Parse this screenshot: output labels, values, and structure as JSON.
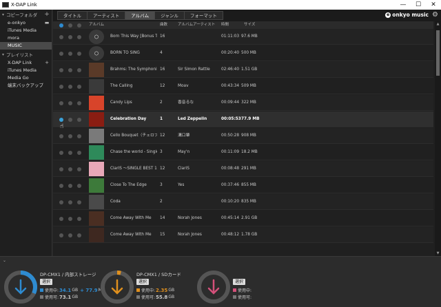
{
  "window": {
    "title": "X-DAP Link",
    "minimize": "—",
    "maximize": "☐",
    "close": "✕"
  },
  "sidebar": {
    "folders_header": "コピーフォルダ",
    "folders": [
      {
        "label": "e-onkyo",
        "folder_icon": true
      },
      {
        "label": "iTunes Media"
      },
      {
        "label": "mora"
      },
      {
        "label": "MUSIC",
        "active": true
      }
    ],
    "playlists_header": "プレイリスト",
    "playlists": [
      {
        "label": "X-DAP Link",
        "plus": true
      },
      {
        "label": "iTunes Media"
      },
      {
        "label": "Media Go"
      },
      {
        "label": "端末バックアップ"
      }
    ]
  },
  "tabs": [
    {
      "label": "タイトル"
    },
    {
      "label": "アーティスト"
    },
    {
      "label": "アルバム",
      "active": true
    },
    {
      "label": "ジャンル"
    },
    {
      "label": "フォーマット"
    }
  ],
  "brand": {
    "logo": "e",
    "label": "onkyo music"
  },
  "table": {
    "headers": {
      "album": "アルバム",
      "tracks": "曲数",
      "album_artist": "アルバムアーティスト",
      "time": "時間",
      "size": "サイズ"
    },
    "rows": [
      {
        "album": "Born This Way [Bonus Tr",
        "tracks": "16",
        "artist": "",
        "time": "01:11:03",
        "size": "97.6 MB",
        "art": "disc"
      },
      {
        "album": "BORN TO SING",
        "tracks": "4",
        "artist": "",
        "time": "00:20:40",
        "size": "500 MB",
        "art": "disc"
      },
      {
        "album": "Brahms: The Symphonie",
        "tracks": "16",
        "artist": "Sir Simon Rattle",
        "time": "02:46:40",
        "size": "1.51 GB",
        "art": "#5a3a28"
      },
      {
        "album": "The Calling",
        "tracks": "12",
        "artist": "Moav",
        "time": "00:43:34",
        "size": "509 MB",
        "art": "#3a3a3a"
      },
      {
        "album": "Candy Lips",
        "tracks": "2",
        "artist": "香音るな",
        "time": "00:09:44",
        "size": "322 MB",
        "art": "#d8442a"
      },
      {
        "album": "Celebration Day",
        "tracks": "1",
        "artist": "Led Zeppelin",
        "time": "00:05:53",
        "size": "77.9 MB",
        "art": "#8a1d12",
        "highlight": true
      },
      {
        "album": "Cello Bouquet（チェロブーケ",
        "tracks": "12",
        "artist": "溝口肇",
        "time": "00:50:28",
        "size": "908 MB",
        "art": "#7a7a7a"
      },
      {
        "album": "Chase the world - Single",
        "tracks": "3",
        "artist": "May'n",
        "time": "00:11:09",
        "size": "18.2 MB",
        "art": "#2e8a5a"
      },
      {
        "album": "ClariS ～SINGLE BEST 1s",
        "tracks": "12",
        "artist": "ClariS",
        "time": "00:08:48",
        "size": "291 MB",
        "art": "#e8a8b8"
      },
      {
        "album": "Close To The Edge",
        "tracks": "3",
        "artist": "Yes",
        "time": "00:37:46",
        "size": "855 MB",
        "art": "#3d7a3a"
      },
      {
        "album": "Coda",
        "tracks": "2",
        "artist": "",
        "time": "00:10:20",
        "size": "835 MB",
        "art": "#4a4a4a"
      },
      {
        "album": "Come Away With Me",
        "tracks": "14",
        "artist": "Norah Jones",
        "time": "00:45:14",
        "size": "2.91 GB",
        "art": "#4a2e22"
      },
      {
        "album": "Come Away With Me",
        "tracks": "15",
        "artist": "Norah Jones",
        "time": "00:48:12",
        "size": "1.78 GB",
        "art": "#3e2820"
      }
    ]
  },
  "devices": [
    {
      "name": "DP-CMX1 / 内部ストレージ",
      "select": "選択",
      "used_label": "使用中:",
      "used": "34.1",
      "unit": "GB",
      "add": "+ 77.9",
      "add_unit": "MB",
      "avail_label": "使用可:",
      "avail": "73.1",
      "avail_unit": "GB",
      "ring_color": "#2e8bd0",
      "used_pct": 32
    },
    {
      "name": "DP-CMX1 / SDカード",
      "select": "選択",
      "used_label": "使用中:",
      "used": "2.35",
      "unit": "GB",
      "add": "",
      "add_unit": "",
      "avail_label": "使用可:",
      "avail": "55.8",
      "avail_unit": "GB",
      "ring_color": "#e0901e",
      "used_pct": 4
    },
    {
      "name": "",
      "select": "選択",
      "used_label": "使用中:",
      "used": "",
      "unit": "",
      "add": "",
      "add_unit": "",
      "avail_label": "使用可:",
      "avail": "",
      "avail_unit": "",
      "ring_color": "#d4507a",
      "used_pct": 0
    }
  ]
}
